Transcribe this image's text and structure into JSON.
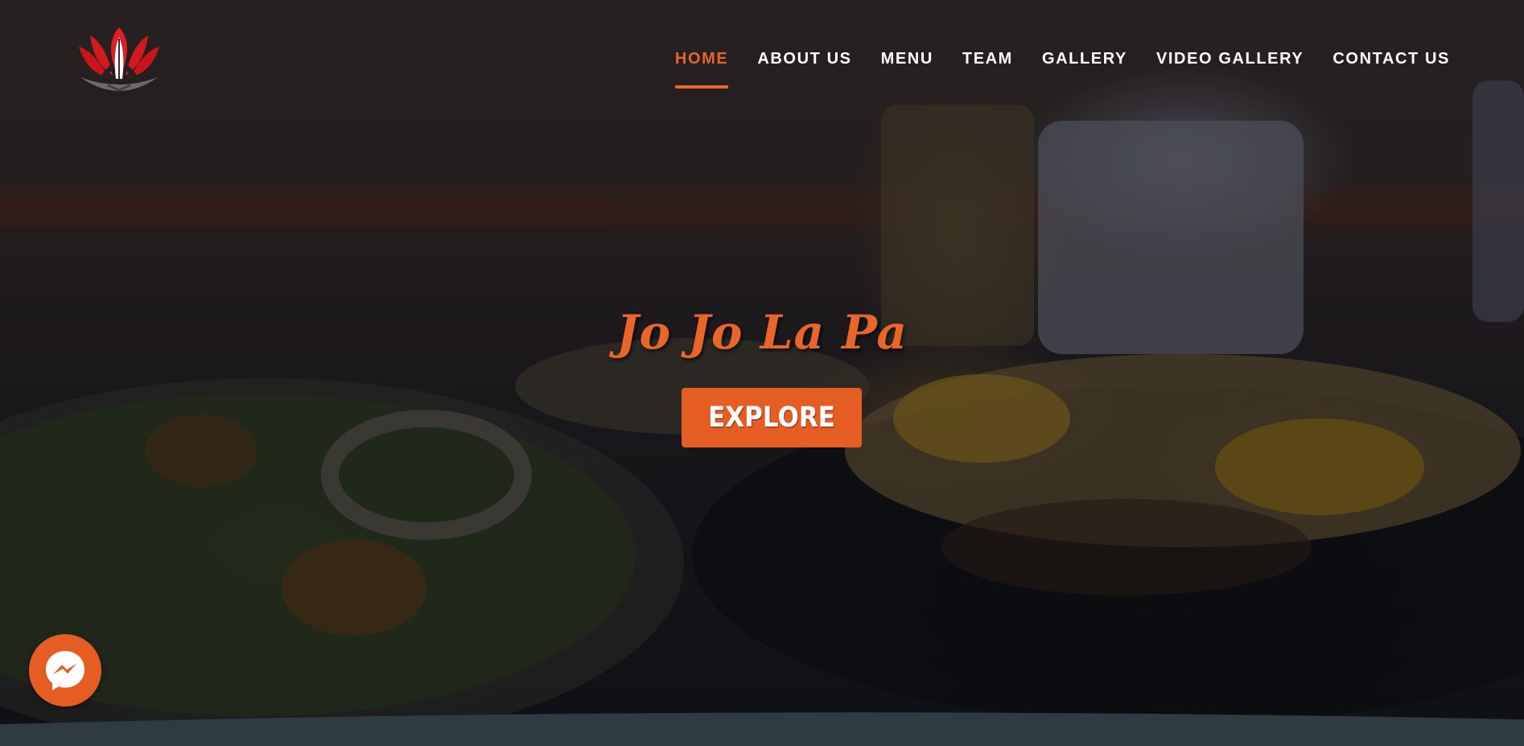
{
  "brand": {
    "logo_icon": "lotus-praying-hands-icon",
    "accent_color": "#e8662a",
    "button_color": "#e65d24"
  },
  "nav": {
    "items": [
      {
        "label": "HOME",
        "active": true
      },
      {
        "label": "ABOUT US",
        "active": false
      },
      {
        "label": "MENU",
        "active": false
      },
      {
        "label": "TEAM",
        "active": false
      },
      {
        "label": "GALLERY",
        "active": false
      },
      {
        "label": "VIDEO GALLERY",
        "active": false
      },
      {
        "label": "CONTACT US",
        "active": false
      }
    ]
  },
  "hero": {
    "title": "Jo Jo La Pa",
    "cta_label": "EXPLORE"
  },
  "chat": {
    "icon": "messenger-icon"
  }
}
